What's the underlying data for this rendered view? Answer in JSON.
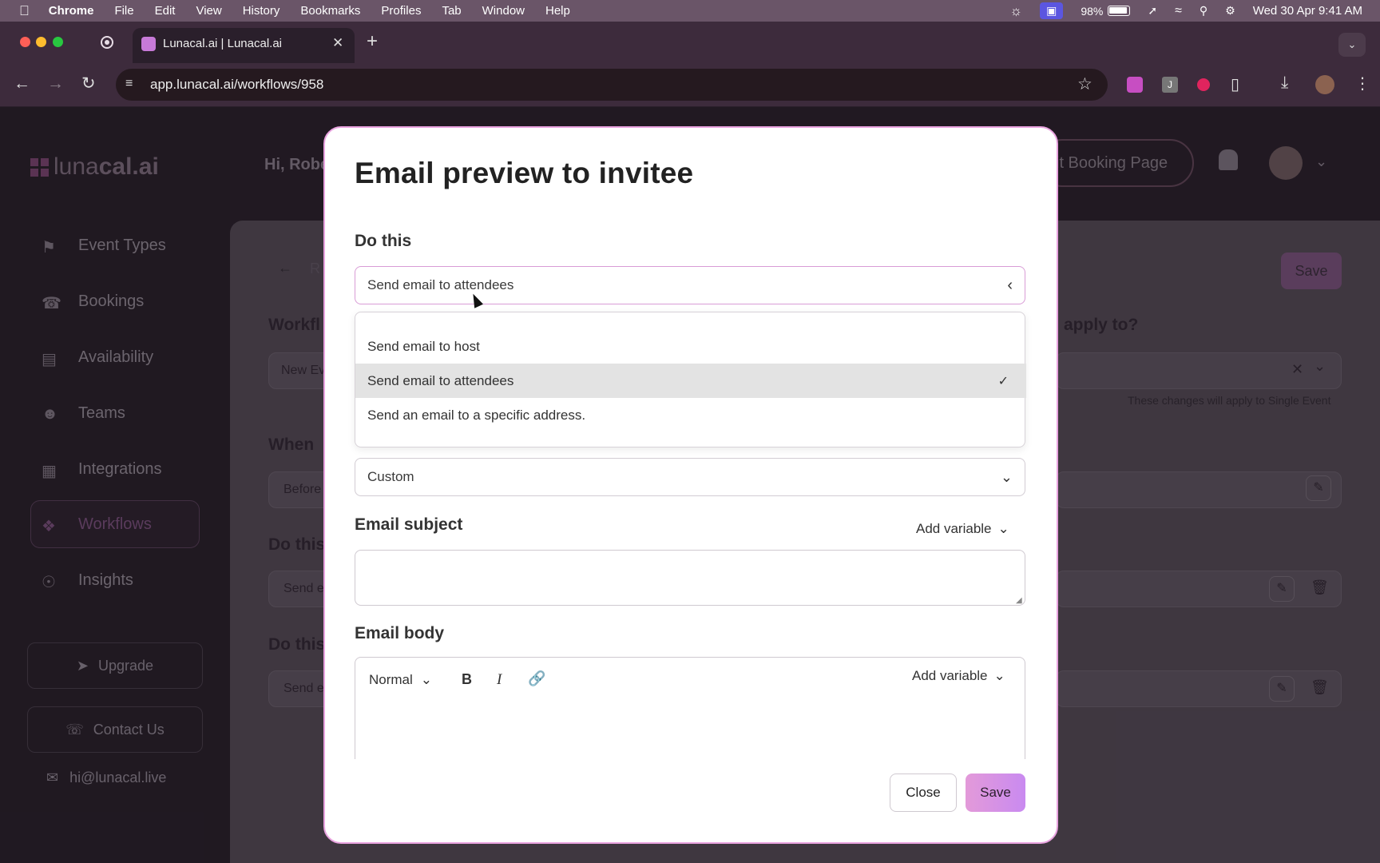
{
  "menubar": {
    "app": "Chrome",
    "items": [
      "File",
      "Edit",
      "View",
      "History",
      "Bookmarks",
      "Profiles",
      "Tab",
      "Window",
      "Help"
    ],
    "battery": "98%",
    "datetime": "Wed 30 Apr  9:41 AM"
  },
  "browser": {
    "tab_title": "Lunacal.ai | Lunacal.ai",
    "url": "app.lunacal.ai/workflows/958"
  },
  "app": {
    "logo_a": "luna",
    "logo_b": "cal.ai",
    "greeting": "Hi, Robe",
    "edit_booking": "it Booking Page",
    "nav": [
      "Event Types",
      "Bookings",
      "Availability",
      "Teams",
      "Integrations",
      "Workflows",
      "Insights"
    ],
    "upgrade": "Upgrade",
    "contact": "Contact Us",
    "email": "hi@lunacal.live",
    "bg": {
      "back_text": "R",
      "save": "Save",
      "workflow_label": "Workfl",
      "workflow_value": "New Ev",
      "apply_label": "apply to?",
      "apply_note": "These changes will apply to Single Event",
      "when_label": "When",
      "when_value": "Before",
      "do1_label": "Do this",
      "do1_value": "Send e",
      "do2_label": "Do this",
      "do2_value": "Send e"
    }
  },
  "modal": {
    "title": "Email preview to invitee",
    "do_label": "Do this",
    "selected": "Send email to attendees",
    "options": [
      {
        "label": "Send email to host",
        "selected": false
      },
      {
        "label": "Send email to attendees",
        "selected": true
      },
      {
        "label": "Send an email to a specific address.",
        "selected": false
      }
    ],
    "template_value": "Custom",
    "subject_label": "Email subject",
    "add_variable": "Add variable",
    "subject_value": "",
    "body_label": "Email body",
    "format": "Normal",
    "close": "Close",
    "save": "Save"
  },
  "colors": {
    "accent": "#d58be6",
    "modal_border": "#e9a3e0",
    "save_btn": "#d78de7"
  }
}
